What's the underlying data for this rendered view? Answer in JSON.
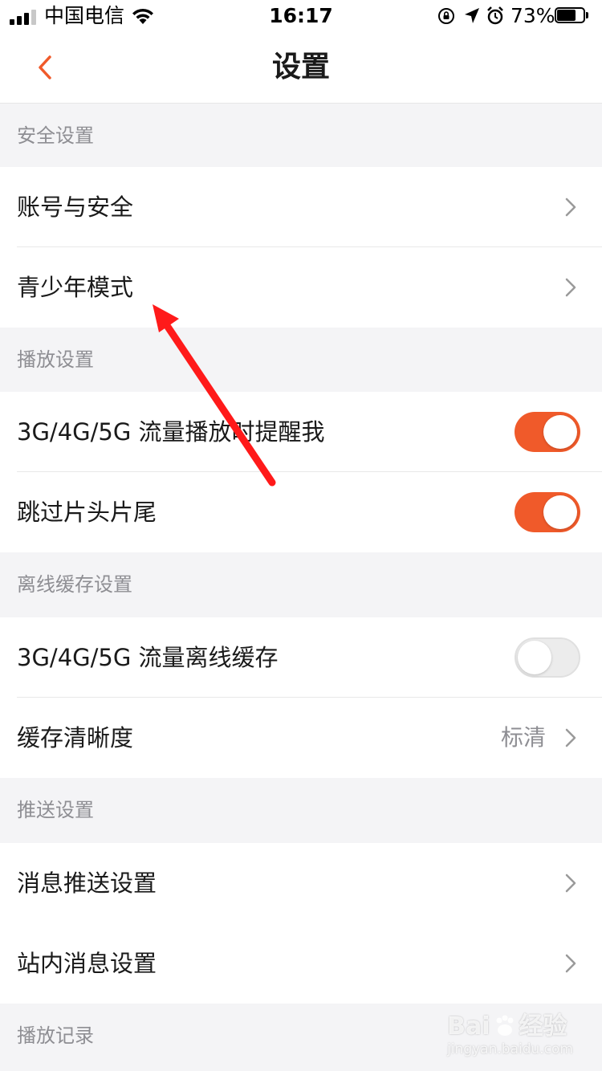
{
  "status_bar": {
    "carrier": "中国电信",
    "time": "16:17",
    "battery_percent": "73%",
    "battery_level": 0.73,
    "icons": [
      "signal-icon",
      "wifi-icon",
      "orientation-lock-icon",
      "location-icon",
      "alarm-icon",
      "battery-icon"
    ]
  },
  "nav": {
    "title": "设置",
    "back_icon": "chevron-left-icon",
    "accent_color": "#f05a2a"
  },
  "sections": {
    "security": {
      "header": "安全设置",
      "account": {
        "label": "账号与安全"
      },
      "teen": {
        "label": "青少年模式"
      }
    },
    "playback": {
      "header": "播放设置",
      "mobile_remind": {
        "label": "3G/4G/5G 流量播放时提醒我",
        "on": true
      },
      "skip": {
        "label": "跳过片头片尾",
        "on": true
      }
    },
    "offline": {
      "header": "离线缓存设置",
      "mobile_cache": {
        "label": "3G/4G/5G 流量离线缓存",
        "on": false
      },
      "quality": {
        "label": "缓存清晰度",
        "value": "标清"
      }
    },
    "push": {
      "header": "推送设置",
      "message_push": {
        "label": "消息推送设置"
      },
      "inbox": {
        "label": "站内消息设置"
      }
    },
    "history": {
      "header": "播放记录"
    }
  },
  "annotation": {
    "color": "#ff1a1a"
  },
  "watermark": {
    "brand": "Bai",
    "brand2": "经验",
    "url": "jingyan.baidu.com"
  }
}
